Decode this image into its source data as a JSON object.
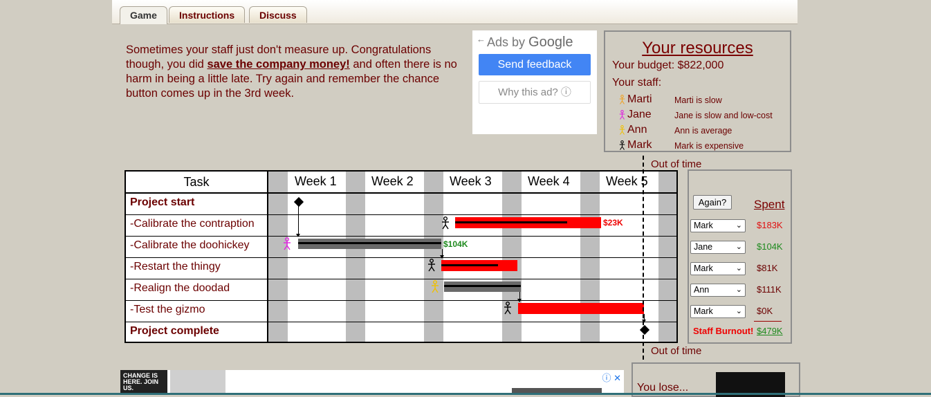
{
  "tabs": [
    {
      "label": "Game"
    },
    {
      "label": "Instructions"
    },
    {
      "label": "Discuss"
    }
  ],
  "message": {
    "part1": "Sometimes your staff just don't measure up. Congratulations though, you did ",
    "link": "save the company money!",
    "part2": " and often there is no harm in being a little late. Try again and remember the chance button comes up in the 3rd week."
  },
  "ad": {
    "ads_by": "Ads by",
    "google": "Google",
    "feedback": "Send feedback",
    "why": "Why this ad? ⓘ"
  },
  "resources": {
    "title": "Your resources",
    "budget": "Your budget: $822,000",
    "staff_label": "Your staff:",
    "staff": [
      {
        "name": "Marti",
        "desc": "Marti is slow",
        "color": "#f0a020"
      },
      {
        "name": "Jane",
        "desc": "Jane is slow and low-cost",
        "color": "#e020e0"
      },
      {
        "name": "Ann",
        "desc": "Ann is average",
        "color": "#f0c000"
      },
      {
        "name": "Mark",
        "desc": "Mark is expensive",
        "color": "#000000"
      }
    ]
  },
  "gantt": {
    "task_header": "Task",
    "weeks": [
      "Week 1",
      "Week 2",
      "Week 3",
      "Week 4",
      "Week 5"
    ],
    "tasks": [
      {
        "name": "Project start",
        "bold": true
      },
      {
        "name": "-Calibrate the contraption",
        "bold": false
      },
      {
        "name": "-Calibrate the doohickey",
        "bold": false
      },
      {
        "name": "-Restart the thingy",
        "bold": false
      },
      {
        "name": "-Realign the doodad",
        "bold": false
      },
      {
        "name": "-Test the gizmo",
        "bold": false
      },
      {
        "name": "Project complete",
        "bold": true
      }
    ],
    "bar_costs": [
      "$23K",
      "$104K"
    ]
  },
  "deadline": {
    "top_label": "Out of time",
    "bottom_label": "Out of time"
  },
  "panel": {
    "again": "Again?",
    "spent_label": "Spent",
    "rows": [
      {
        "person": "Mark",
        "spent": "$183K",
        "color": "#e01010"
      },
      {
        "person": "Jane",
        "spent": "$104K",
        "color": "#1e8a1e"
      },
      {
        "person": "Mark",
        "spent": "$81K",
        "color": "#6b0000"
      },
      {
        "person": "Ann",
        "spent": "$111K",
        "color": "#6b0000"
      },
      {
        "person": "Mark",
        "spent": "$0K",
        "color": "#6b0000"
      }
    ],
    "burnout": "Staff Burnout!",
    "total": "$479K"
  },
  "bottom_ad": {
    "logo": "CHANGE IS HERE. JOIN US.",
    "controls": "ⓘ ✕"
  },
  "lose": {
    "text": "You lose..."
  }
}
